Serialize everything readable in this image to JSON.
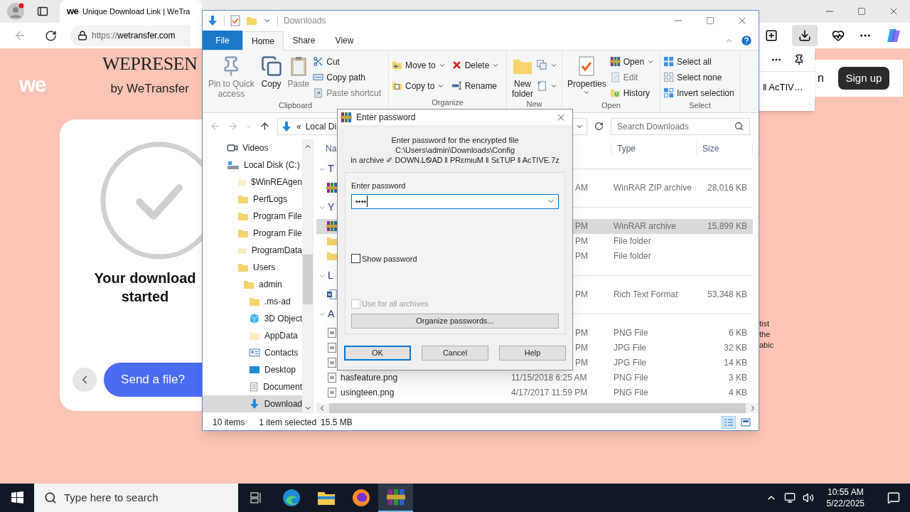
{
  "browser": {
    "tab": {
      "favicon": "we",
      "title": "Unique Download Link | WeTra",
      "selected": true
    },
    "url": {
      "scheme": "https://",
      "host": "wetransfer.com"
    },
    "page": {
      "logo": "we",
      "brand": "WEPRESEN",
      "brand_sub": "by WeTransfer",
      "heading": "Your download started",
      "send_button": "Send a file?",
      "header_fragment": "n",
      "signup": "Sign up",
      "fragments": [
        "tist",
        "the",
        "abic"
      ]
    },
    "download_popup": {
      "file": "‖ AcTIV…"
    }
  },
  "explorer": {
    "title": "Downloads",
    "ribbon_tabs": [
      {
        "label": "File",
        "kind": "file",
        "selected": false
      },
      {
        "label": "Home",
        "kind": "tab",
        "selected": true
      },
      {
        "label": "Share",
        "kind": "tab",
        "selected": false
      },
      {
        "label": "View",
        "kind": "tab",
        "selected": false
      }
    ],
    "ribbon_groups": [
      {
        "label": "Clipboard",
        "items": [
          {
            "kind": "large",
            "label": "Pin to Quick access",
            "disabled": true
          },
          {
            "kind": "large",
            "label": "Copy",
            "disabled": false
          },
          {
            "kind": "large",
            "label": "Paste",
            "disabled": true
          },
          {
            "kind": "stack",
            "items": [
              {
                "label": "Cut",
                "disabled": false
              },
              {
                "label": "Copy path",
                "disabled": false
              },
              {
                "label": "Paste shortcut",
                "disabled": true
              }
            ]
          }
        ]
      },
      {
        "label": "Organize",
        "items": [
          {
            "kind": "stack",
            "items": [
              {
                "label": "Move to",
                "menu": true,
                "disabled": false
              },
              {
                "label": "Copy to",
                "menu": true,
                "disabled": false
              }
            ]
          },
          {
            "kind": "stack",
            "items": [
              {
                "label": "Delete",
                "menu": true,
                "disabled": false
              },
              {
                "label": "Rename",
                "disabled": false
              }
            ]
          }
        ]
      },
      {
        "label": "New",
        "items": [
          {
            "kind": "large",
            "label": "New folder",
            "disabled": false
          },
          {
            "kind": "stack",
            "items": [
              {
                "menu": true,
                "disabled": false
              },
              {
                "menu": true,
                "disabled": false
              }
            ]
          }
        ]
      },
      {
        "label": "Open",
        "items": [
          {
            "kind": "large",
            "label": "Properties",
            "menu": true,
            "disabled": false
          },
          {
            "kind": "stack",
            "items": [
              {
                "label": "Open",
                "menu": true,
                "disabled": false
              },
              {
                "label": "Edit",
                "disabled": true
              },
              {
                "label": "History",
                "disabled": false
              }
            ]
          }
        ]
      },
      {
        "label": "Select",
        "items": [
          {
            "kind": "stack",
            "items": [
              {
                "label": "Select all",
                "disabled": false
              },
              {
                "label": "Select none",
                "disabled": false
              },
              {
                "label": "Invert selection",
                "disabled": false
              }
            ]
          }
        ]
      }
    ],
    "address": {
      "prefix": "«",
      "crumb": "Local Di"
    },
    "search": {
      "placeholder": "Search Downloads"
    },
    "nav": [
      {
        "label": "Videos",
        "kind": "videos",
        "selected": false
      },
      {
        "label": "Local Disk (C:)",
        "kind": "disk",
        "selected": false,
        "children": [
          {
            "label": "$WinREAgen",
            "kind": "folder_hidden",
            "selected": false
          },
          {
            "label": "PerfLogs",
            "kind": "folder",
            "selected": false
          },
          {
            "label": "Program File",
            "kind": "folder",
            "selected": false
          },
          {
            "label": "Program File",
            "kind": "folder",
            "selected": false
          },
          {
            "label": "ProgramData",
            "kind": "folder_hidden",
            "selected": false
          },
          {
            "label": "Users",
            "kind": "folder",
            "selected": false,
            "children": [
              {
                "label": "admin",
                "kind": "folder",
                "selected": false,
                "children": [
                  {
                    "label": ".ms-ad",
                    "kind": "folder",
                    "selected": false
                  },
                  {
                    "label": "3D Object",
                    "kind": "cube",
                    "selected": false
                  },
                  {
                    "label": "AppData",
                    "kind": "folder_hidden",
                    "selected": false
                  },
                  {
                    "label": "Contacts",
                    "kind": "contacts",
                    "selected": false
                  },
                  {
                    "label": "Desktop",
                    "kind": "desktop",
                    "selected": false
                  },
                  {
                    "label": "Document",
                    "kind": "documents",
                    "selected": false
                  },
                  {
                    "label": "Download",
                    "kind": "downloads",
                    "selected": true
                  }
                ]
              }
            ]
          }
        ]
      }
    ],
    "columns": [
      "Na",
      "Type",
      "Size"
    ],
    "groups": [
      {
        "header": "T",
        "rows": [
          {
            "kind": "archive",
            "date": "AM",
            "type": "WinRAR ZIP archive",
            "size": "28,016 KB",
            "selected": false
          }
        ]
      },
      {
        "header": "Y",
        "rows": [
          {
            "kind": "archive",
            "date": "PM",
            "type": "WinRAR archive",
            "size": "15,899 KB",
            "selected": true
          },
          {
            "kind": "folder",
            "date": "PM",
            "type": "File folder",
            "selected": false
          },
          {
            "kind": "folder",
            "date": "PM",
            "type": "File folder",
            "selected": false
          }
        ]
      },
      {
        "header": "L",
        "rows": [
          {
            "kind": "word",
            "date": "PM",
            "type": "Rich Text Format",
            "size": "53,348 KB",
            "selected": false
          }
        ]
      },
      {
        "header": "A",
        "rows": [
          {
            "kind": "image",
            "date": "PM",
            "type": "PNG File",
            "size": "6 KB",
            "selected": false
          },
          {
            "kind": "image",
            "date": "PM",
            "type": "JPG File",
            "size": "32 KB",
            "selected": false
          },
          {
            "kind": "image",
            "date": "PM",
            "type": "JPG File",
            "size": "14 KB",
            "selected": false
          },
          {
            "kind": "image",
            "name": "hasfeature.png",
            "date": "11/15/2018 6:25 AM",
            "type": "PNG File",
            "size": "3 KB",
            "selected": false
          },
          {
            "kind": "image",
            "name": "usingteen.png",
            "date": "4/17/2017 11:59 PM",
            "type": "PNG File",
            "size": "4 KB",
            "selected": false
          }
        ]
      }
    ],
    "status": {
      "count": "10 items",
      "selection": "1 item selected",
      "size": "15.5 MB"
    },
    "views": [
      {
        "kind": "details",
        "selected": true
      },
      {
        "kind": "tiles",
        "selected": false
      }
    ]
  },
  "dialog": {
    "title": "Enter password",
    "info": [
      "Enter password for the encrypted file",
      "C:\\Users\\admin\\Downloads\\Config",
      "in archive ✐ DOWN.ᏞᏫᎪᎠ ‖ PRεmιuM ‖ SεTUP ‖ AcTIVE.7z"
    ],
    "field_label": "Enter password",
    "password": "••••",
    "checks": [
      {
        "label": "Show password",
        "checked": false,
        "disabled": false
      },
      {
        "label": "Use for all archives",
        "checked": false,
        "disabled": true
      }
    ],
    "organize": "Organize passwords...",
    "buttons": [
      {
        "label": "OK",
        "default": true
      },
      {
        "label": "Cancel",
        "default": false
      },
      {
        "label": "Help",
        "default": false
      }
    ]
  },
  "taskbar": {
    "search": {
      "placeholder": "Type here to search"
    },
    "apps": [
      {
        "kind": "taskview",
        "selected": false
      },
      {
        "kind": "edge",
        "selected": false
      },
      {
        "kind": "explorer",
        "selected": false
      },
      {
        "kind": "firefox",
        "selected": false
      },
      {
        "kind": "winrar",
        "selected": true
      }
    ],
    "time": "10:55 AM",
    "date": "5/22/2025"
  }
}
